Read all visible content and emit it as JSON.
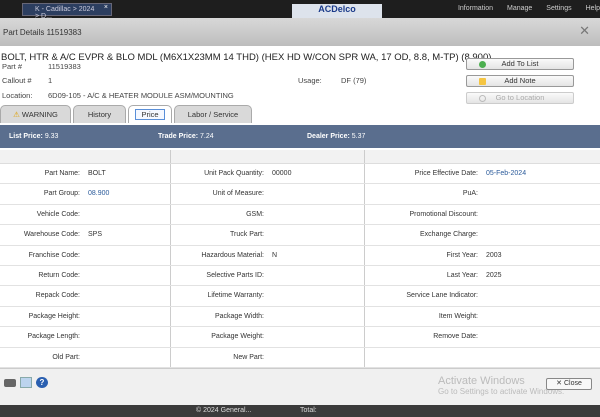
{
  "topbar": {
    "crumb": "K - Cadillac > 2024 > D...",
    "logo": "ACDelco",
    "nav": [
      "Information",
      "Manage",
      "Settings",
      "Help"
    ]
  },
  "dialog": {
    "title": "Part Details 11519383"
  },
  "part": {
    "description": "BOLT, HTR & A/C EVPR & BLO MDL (M6X1X23MM 14 THD) (HEX HD W/CON SPR WA, 17 OD, 8.8, M-TP) (8.900)",
    "part_no_label": "Part #",
    "part_no": "11519383",
    "callout_label": "Callout #",
    "callout": "1",
    "usage_label": "Usage:",
    "usage": "DF (79)",
    "location_label": "Location:",
    "location": "6D09-105 - A/C & HEATER MODULE ASM/MOUNTING"
  },
  "actions": {
    "add_to_list": "Add To List",
    "add_note": "Add Note",
    "go_to_location": "Go to Location"
  },
  "tabs": [
    "WARNING",
    "History",
    "Price",
    "Labor / Service"
  ],
  "prices": {
    "list_label": "List Price:",
    "list": "9.33",
    "trade_label": "Trade Price:",
    "trade": "7.24",
    "dealer_label": "Dealer Price:",
    "dealer": "5.37"
  },
  "rows": [
    [
      [
        "Part Name:",
        "BOLT"
      ],
      [
        "Unit Pack Quantity:",
        "00000"
      ],
      [
        "Price Effective Date:",
        "05-Feb-2024"
      ]
    ],
    [
      [
        "Part Group:",
        "08.900"
      ],
      [
        "Unit of Measure:",
        ""
      ],
      [
        "PuA:",
        ""
      ]
    ],
    [
      [
        "Vehicle Code:",
        ""
      ],
      [
        "GSM:",
        ""
      ],
      [
        "Promotional Discount:",
        ""
      ]
    ],
    [
      [
        "Warehouse Code:",
        "SPS"
      ],
      [
        "Truck Part:",
        ""
      ],
      [
        "Exchange Charge:",
        ""
      ]
    ],
    [
      [
        "Franchise Code:",
        ""
      ],
      [
        "Hazardous Material:",
        "N"
      ],
      [
        "First Year:",
        "2003"
      ]
    ],
    [
      [
        "Return Code:",
        ""
      ],
      [
        "Selective Parts ID:",
        ""
      ],
      [
        "Last Year:",
        "2025"
      ]
    ],
    [
      [
        "Repack Code:",
        ""
      ],
      [
        "Lifetime Warranty:",
        ""
      ],
      [
        "Service Lane Indicator:",
        ""
      ]
    ],
    [
      [
        "Package Height:",
        ""
      ],
      [
        "Package Width:",
        ""
      ],
      [
        "Item Weight:",
        ""
      ]
    ],
    [
      [
        "Package Length:",
        ""
      ],
      [
        "Package Weight:",
        ""
      ],
      [
        "Remove Date:",
        ""
      ]
    ],
    [
      [
        "Old Part:",
        ""
      ],
      [
        "New Part:",
        ""
      ],
      [
        "",
        ""
      ]
    ]
  ],
  "footer": {
    "watermark_title": "Activate Windows",
    "watermark_sub": "Go to Settings to activate Windows.",
    "close": "Close"
  },
  "bottom": {
    "copyright": "© 2024 General...",
    "total": "Total:"
  }
}
